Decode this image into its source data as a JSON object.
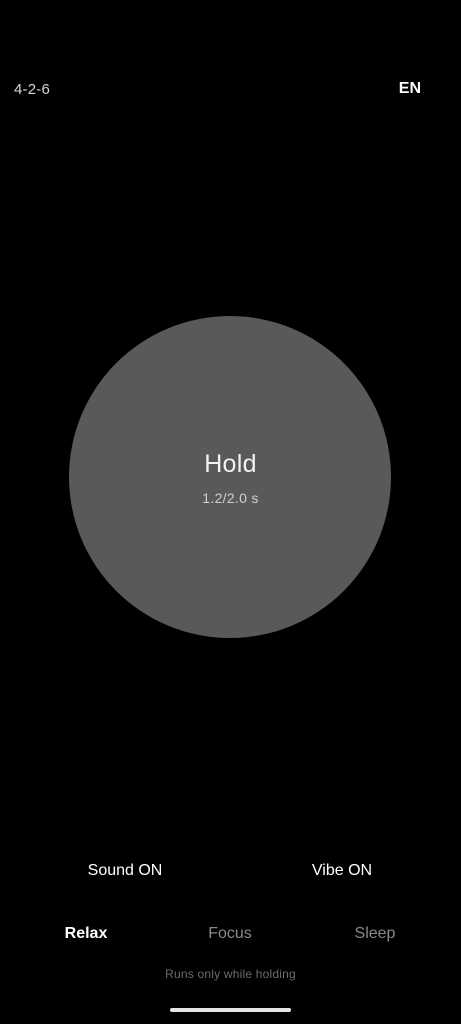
{
  "header": {
    "pattern": "4-2-6",
    "language": "EN"
  },
  "breath": {
    "phase": "Hold",
    "timer": "1.2/2.0 s"
  },
  "toggles": {
    "sound": "Sound ON",
    "vibe": "Vibe ON"
  },
  "modes": [
    {
      "label": "Relax",
      "selected": true
    },
    {
      "label": "Focus",
      "selected": false
    },
    {
      "label": "Sleep",
      "selected": false
    }
  ],
  "footer": {
    "hint": "Runs only while holding"
  },
  "colors": {
    "background": "#000000",
    "circle": "#595959",
    "active_text": "#ffffff",
    "inactive_text": "#8a8a8a"
  }
}
